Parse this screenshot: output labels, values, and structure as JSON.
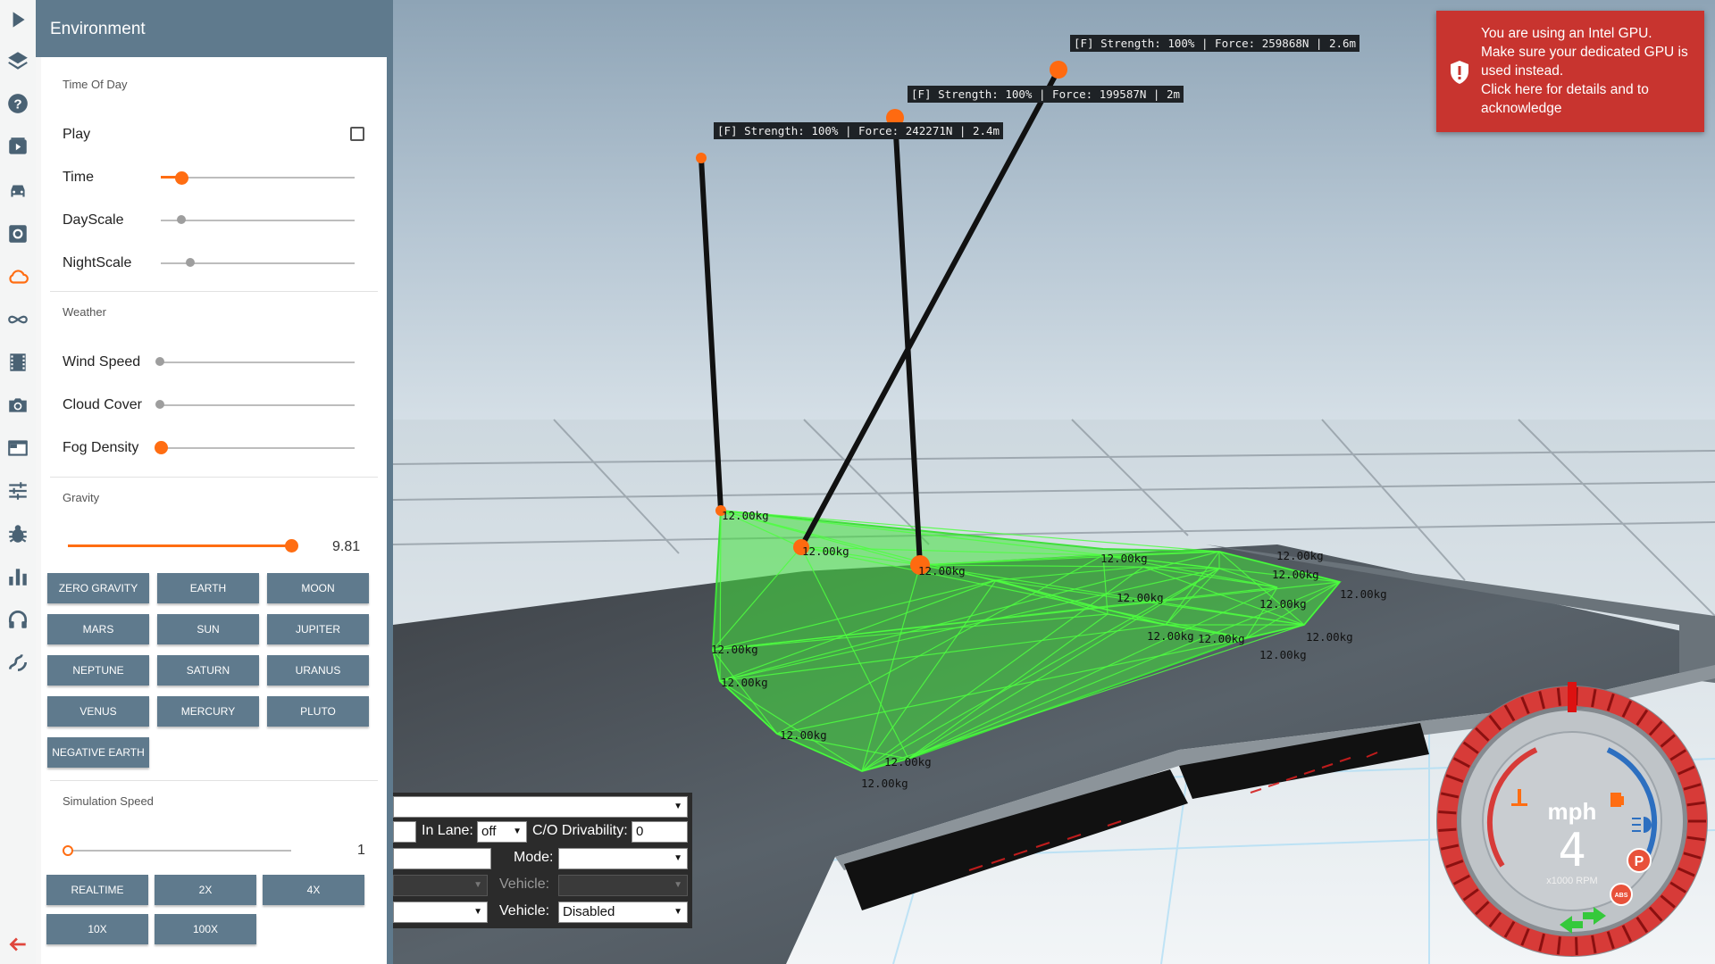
{
  "window": {
    "width": 1920,
    "height": 1080
  },
  "sidebar_icons": [
    "play-icon",
    "layers-icon",
    "help-icon",
    "replay-icon",
    "car-icon",
    "settings-icon",
    "cloud-icon",
    "infinity-icon",
    "film-icon",
    "camera-icon",
    "window-icon",
    "sliders-icon",
    "bug-icon",
    "bar-chart-icon",
    "headphones-icon",
    "route-icon",
    "back-arrow-icon"
  ],
  "environment": {
    "title": "Environment",
    "time_of_day": {
      "section": "Time Of Day",
      "play_label": "Play",
      "play_checked": false,
      "time_label": "Time",
      "time_value": 0.1,
      "dayscale_label": "DayScale",
      "dayscale_value": 0.1,
      "nightscale_label": "NightScale",
      "nightscale_value": 0.15
    },
    "weather": {
      "section": "Weather",
      "wind_label": "Wind Speed",
      "wind_value": 0,
      "cloud_label": "Cloud Cover",
      "cloud_value": 0,
      "fog_label": "Fog Density",
      "fog_value": 0
    },
    "gravity": {
      "section": "Gravity",
      "value": "9.81",
      "slider_fraction": 1.0,
      "presets": [
        "ZERO GRAVITY",
        "EARTH",
        "MOON",
        "MARS",
        "SUN",
        "JUPITER",
        "NEPTUNE",
        "SATURN",
        "URANUS",
        "VENUS",
        "MERCURY",
        "PLUTO",
        "NEGATIVE EARTH"
      ]
    },
    "simulation_speed": {
      "section": "Simulation Speed",
      "value": "1",
      "slider_fraction": 0.0,
      "presets": [
        "REALTIME",
        "2X",
        "4X",
        "10X",
        "100X"
      ]
    }
  },
  "scene": {
    "force_labels": [
      "[F] Strength: 100% | Force: 259868N | 2.6m",
      "[F] Strength: 100% | Force: 199587N | 2m",
      "[F] Strength: 100% | Force: 242271N | 2.4m"
    ],
    "node_mass": "12.00kg",
    "mesh_color": "#3fe03a",
    "tether_color": "#111111",
    "node_color": "#ff6a10"
  },
  "vehicle_panel": {
    "in_lane_label": "In Lane:",
    "in_lane_value": "off",
    "co_drivability_label": "C/O Drivability:",
    "co_drivability_value": "0",
    "mode_label": "Mode:",
    "mode_value": "",
    "vehicle_label_1": "Vehicle:",
    "vehicle_value_1": "",
    "vehicle_label_2": "Vehicle:",
    "vehicle_value_2": "Disabled"
  },
  "gpu_warning": {
    "line1": "You are using an Intel GPU.",
    "line2": "Make sure your dedicated GPU is used instead.",
    "line3": "Click here for details and to acknowledge"
  },
  "dashboard": {
    "speed_unit": "mph",
    "speed": "4",
    "rpm_label": "x1000 RPM",
    "gear": "P",
    "abs": "ABS"
  }
}
